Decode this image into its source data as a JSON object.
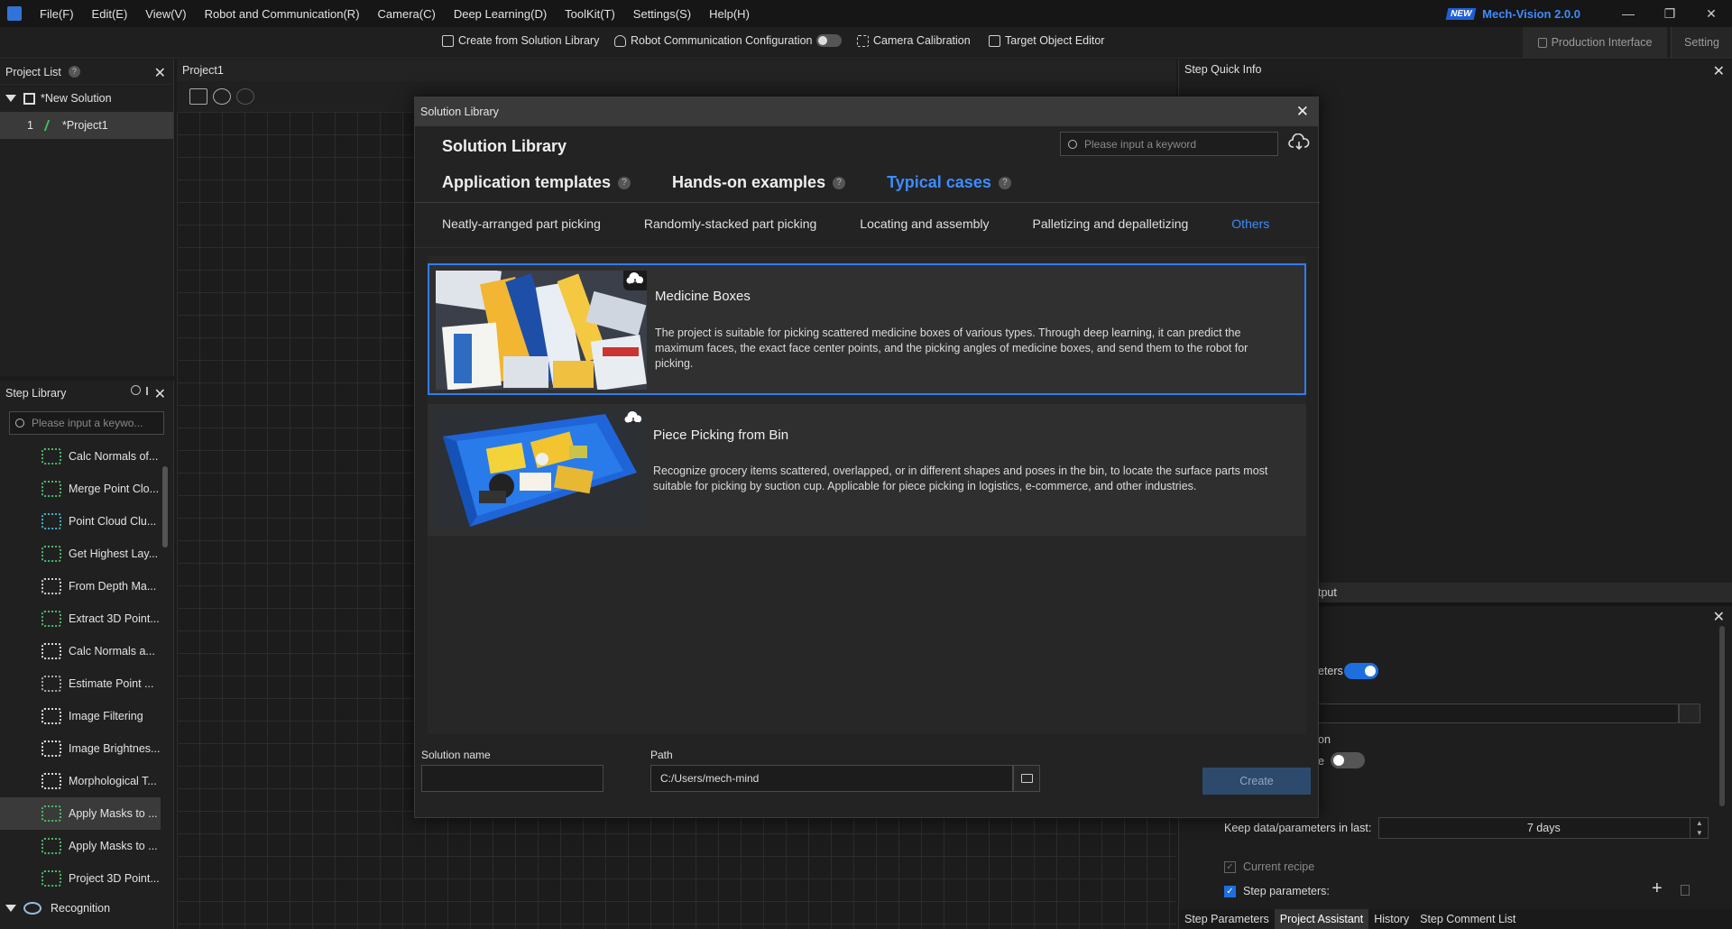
{
  "menubar": {
    "items": [
      "File(F)",
      "Edit(E)",
      "View(V)",
      "Robot and Communication(R)",
      "Camera(C)",
      "Deep Learning(D)",
      "ToolKit(T)",
      "Settings(S)",
      "Help(H)"
    ],
    "badge": "NEW",
    "app_title": "Mech-Vision 2.0.0",
    "window_buttons": [
      "—",
      "❐",
      "✕"
    ]
  },
  "toolbar": {
    "create_from_library": "Create from Solution Library",
    "robot_comm": "Robot Communication Configuration",
    "camera_calibration": "Camera Calibration",
    "target_editor": "Target Object Editor",
    "production_interface": "Production Interface",
    "setting": "Setting"
  },
  "project_list": {
    "title": "Project List",
    "help": "?",
    "close": "✕",
    "solution": "*New Solution",
    "project_index": "1",
    "project_name": "*Project1"
  },
  "step_library": {
    "title": "Step Library",
    "search_placeholder": "Please input a keywo...",
    "close": "✕",
    "items": [
      {
        "label": "Calc Normals of...",
        "icon": "normals-icon"
      },
      {
        "label": "Merge Point Clo...",
        "icon": "merge-points-icon"
      },
      {
        "label": "Point Cloud Clu...",
        "icon": "cluster-icon"
      },
      {
        "label": "Get Highest Lay...",
        "icon": "layer-icon"
      },
      {
        "label": "From Depth Ma...",
        "icon": "depth-map-icon"
      },
      {
        "label": "Extract 3D Point...",
        "icon": "extract-points-icon"
      },
      {
        "label": "Calc Normals a...",
        "icon": "normals-angle-icon"
      },
      {
        "label": "Estimate Point ...",
        "icon": "estimate-icon"
      },
      {
        "label": "Image Filtering",
        "icon": "image-filter-icon"
      },
      {
        "label": "Image Brightnes...",
        "icon": "brightness-icon"
      },
      {
        "label": "Morphological T...",
        "icon": "morphology-icon"
      },
      {
        "label": "Apply Masks to ...",
        "icon": "mask-icon"
      },
      {
        "label": "Apply Masks to ...",
        "icon": "mask-icon"
      },
      {
        "label": "Project 3D Point...",
        "icon": "project-points-icon"
      }
    ],
    "group": "Recognition"
  },
  "canvas": {
    "tab": "Project1"
  },
  "quick_info": {
    "title": "Step Quick Info",
    "close": "✕"
  },
  "lower_panel": {
    "strip_label": "tput",
    "close": "✕",
    "toggle_label": "eters",
    "on_label": "on",
    "e_label": "e",
    "keep_label": "Keep data/parameters in last:",
    "keep_value": "7 days",
    "current_recipe": "Current recipe",
    "step_parameters": "Step parameters:",
    "add": "+",
    "tabs": [
      "Step Parameters",
      "Project Assistant",
      "History",
      "Step Comment List"
    ]
  },
  "dialog": {
    "title": "Solution Library",
    "close": "✕",
    "heading": "Solution Library",
    "search_placeholder": "Please input a keyword",
    "categories": [
      "Application templates",
      "Hands-on examples",
      "Typical cases"
    ],
    "active_category": "Typical cases",
    "subtabs": [
      "Neatly-arranged part picking",
      "Randomly-stacked part picking",
      "Locating and assembly",
      "Palletizing and depalletizing",
      "Others"
    ],
    "active_subtab": "Others",
    "cards": [
      {
        "title": "Medicine Boxes",
        "desc": "The project is suitable for picking scattered medicine boxes of various types. Through deep learning, it can predict the maximum faces, the exact face center points, and the picking angles of medicine boxes, and send them to the robot for picking."
      },
      {
        "title": "Piece Picking from Bin",
        "desc": "Recognize grocery items scattered, overlapped, or in different shapes and poses in the bin, to locate the surface parts most suitable for picking by suction cup. Applicable for piece picking in logistics, e-commerce, and other industries."
      }
    ],
    "solution_name_label": "Solution name",
    "solution_name_value": "",
    "path_label": "Path",
    "path_value": "C:/Users/mech-mind",
    "create": "Create"
  },
  "colors": {
    "accent": "#3d8cff",
    "selection_border": "#2f7df0",
    "create_disabled": "#2d4a6d"
  }
}
